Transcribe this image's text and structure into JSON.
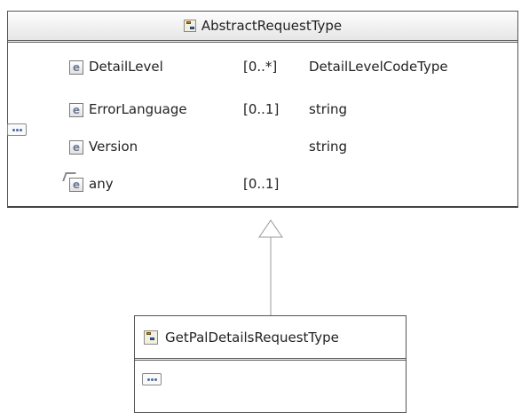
{
  "base_type": {
    "name": "AbstractRequestType",
    "elements": [
      {
        "icon": "e",
        "name": "DetailLevel",
        "cardinality": "[0..*]",
        "type": "DetailLevelCodeType"
      },
      {
        "icon": "e",
        "name": "ErrorLanguage",
        "cardinality": "[0..1]",
        "type": "string"
      },
      {
        "icon": "e",
        "name": "Version",
        "cardinality": "",
        "type": "string"
      },
      {
        "icon": "e",
        "name": "any",
        "cardinality": "[0..1]",
        "type": ""
      }
    ]
  },
  "derived_type": {
    "name": "GetPalDetailsRequestType"
  },
  "colors": {
    "border": "#555555",
    "header_gradient_top": "#fdfdfd",
    "header_gradient_bottom": "#e6e6e6",
    "line": "#999999"
  }
}
